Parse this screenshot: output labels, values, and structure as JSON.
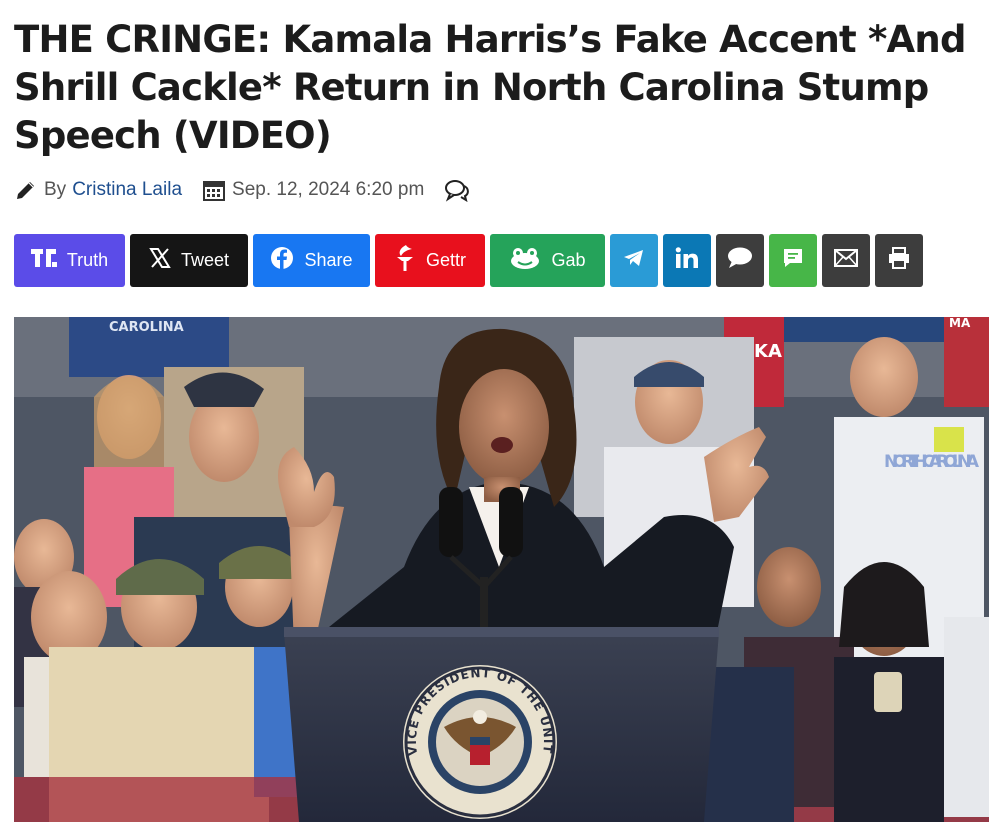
{
  "article": {
    "title": "THE CRINGE: Kamala Harris’s Fake Accent *And Shrill Cackle* Return in North Carolina Stump Speech (VIDEO)",
    "by_label": "By",
    "author": "Cristina Laila",
    "date": "Sep. 12, 2024 6:20 pm"
  },
  "share": {
    "truth": "Truth",
    "tweet": "Tweet",
    "facebook": "Share",
    "gettr": "Gettr",
    "gab": "Gab"
  },
  "photo": {
    "seal_text": "VICE PRESIDENT OF THE UNITED STATES",
    "signs": [
      "CAROLINA",
      "NORTH CAROLINA",
      "KA",
      "MA"
    ]
  },
  "colors": {
    "truth": "#5b4ce8",
    "x": "#151515",
    "facebook": "#1877f2",
    "gettr": "#e8101d",
    "gab": "#25a35a",
    "telegram": "#2a9bd6",
    "linkedin": "#0b78b5",
    "dark": "#3d3d3d",
    "sms": "#47b648",
    "author_link": "#1f4f8f"
  }
}
